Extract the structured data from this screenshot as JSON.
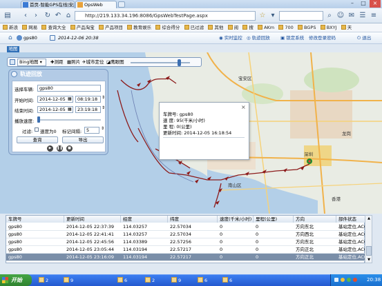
{
  "browser": {
    "tabs": [
      {
        "label": "首页-智能GPS在线|安康在"
      },
      {
        "label": "OpsWeb"
      }
    ],
    "url": "http://219.133.34.196:8086/GpsWebTestPage.aspx",
    "favorites": [
      "新浪",
      "网易",
      "查询大全",
      "产品淘宝",
      "产品项目",
      "教育娱乐",
      "综合得分",
      "已过滤",
      "其他",
      "阅",
      "搜",
      "AKm",
      "700",
      "BGPS",
      "BXYJ",
      "天"
    ]
  },
  "app": {
    "user": "gps80",
    "date": "2014-12-06 20:38",
    "links": [
      "实时监控",
      "轨迹回放",
      "锁定系统",
      "修改登录密码",
      "退出"
    ],
    "map_tab": "地图"
  },
  "toolbar": {
    "map_type": "Bing地图",
    "items": [
      "测距",
      "照片",
      "城市定位",
      "鹰眼图"
    ]
  },
  "panel": {
    "title": "轨迹回放",
    "plate_label": "选择车辆:",
    "plate_value": "gps80",
    "start_label": "开始时间:",
    "start_date": "2014-12-05",
    "start_time": "08:19:18",
    "end_label": "结束时间:",
    "end_date": "2014-12-05",
    "end_time": "23:19:18",
    "speed_label": "播放速度:",
    "filter_label": "过滤:",
    "filter_opt": "速度为0",
    "filter_opt2": "标记间隔:",
    "filter_val": "5",
    "query_btn": "查询",
    "export_btn": "导出"
  },
  "popup": {
    "rows": [
      "车牌号:    gps80",
      "速    度:    95(千米/小时)",
      "里    程:    0(公里)",
      "更新时间:    2014-12-05 16:18:54"
    ]
  },
  "map_labels": [
    {
      "text": "深圳",
      "k": "shenzhen"
    },
    {
      "text": "香港",
      "k": "hk"
    },
    {
      "text": "南山区",
      "k": "nanshan"
    },
    {
      "text": "宝安区",
      "k": "baoan"
    },
    {
      "text": "龙岗",
      "k": "longgang"
    }
  ],
  "table": {
    "headers": [
      "车牌号",
      "更新时间",
      "经度",
      "纬度",
      "速度(千米/小时)",
      "里程(公里)",
      "方向",
      "部件状态"
    ],
    "rows": [
      [
        "gps80",
        "2014-12-05 22:37:39",
        "114.03257",
        "22.57034",
        "0",
        "0",
        "方向东北",
        "基站定位,ACC开"
      ],
      [
        "gps80",
        "2014-12-05 22:41:41",
        "114.03257",
        "22.57034",
        "0",
        "0",
        "方向西北",
        "基站定位,ACC开"
      ],
      [
        "gps80",
        "2014-12-05 22:45:56",
        "114.03389",
        "22.57256",
        "0",
        "0",
        "方向东北",
        "基站定位,ACC开"
      ],
      [
        "gps80",
        "2014-12-05 23:05:44",
        "114.03194",
        "22.57217",
        "0",
        "0",
        "方向正北",
        "基站定位,ACC开"
      ],
      [
        "gps80",
        "2014-12-05 23:16:09",
        "114.03194",
        "22.57217",
        "0",
        "0",
        "方向正北",
        "基站定位,ACC开"
      ]
    ],
    "selected_row": 4
  },
  "taskbar": {
    "start": "开始",
    "items": [
      "2",
      "9",
      "6",
      "2",
      "9",
      "6",
      "6"
    ],
    "clock": "20:38"
  },
  "colors": {
    "route": "#8c1a1a",
    "marker": "#1d8c2f",
    "accent": "#2e6fb7"
  }
}
